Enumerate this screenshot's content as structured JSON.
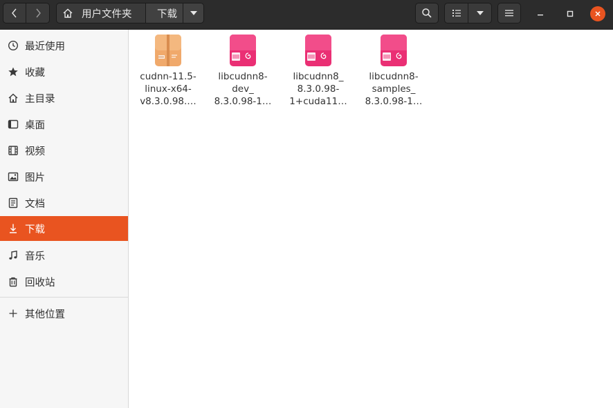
{
  "header": {
    "path": [
      {
        "label": "用户文件夹"
      },
      {
        "label": "下载"
      }
    ]
  },
  "sidebar": {
    "items": [
      {
        "label": "最近使用",
        "icon": "clock-icon"
      },
      {
        "label": "收藏",
        "icon": "star-icon"
      },
      {
        "label": "主目录",
        "icon": "home-icon"
      },
      {
        "label": "桌面",
        "icon": "desktop-icon"
      },
      {
        "label": "视频",
        "icon": "video-icon"
      },
      {
        "label": "图片",
        "icon": "picture-icon"
      },
      {
        "label": "文档",
        "icon": "document-icon"
      },
      {
        "label": "下载",
        "icon": "download-icon",
        "active": true
      },
      {
        "label": "音乐",
        "icon": "music-icon"
      },
      {
        "label": "回收站",
        "icon": "trash-icon"
      },
      {
        "label": "其他位置",
        "icon": "plus-icon"
      }
    ]
  },
  "files": [
    {
      "lines": [
        "cudnn-11.5-",
        "linux-x64-",
        "v8.3.0.98.…"
      ],
      "type": "archive",
      "icon": "archive-icon",
      "color": "#f0a96b"
    },
    {
      "lines": [
        "libcudnn8-",
        "dev_",
        "8.3.0.98-1…"
      ],
      "type": "deb",
      "icon": "debian-package-icon",
      "color": "#f0407f"
    },
    {
      "lines": [
        "libcudnn8_",
        "8.3.0.98-",
        "1+cuda11…"
      ],
      "type": "deb",
      "icon": "debian-package-icon",
      "color": "#f0407f"
    },
    {
      "lines": [
        "libcudnn8-",
        "samples_",
        "8.3.0.98-1…"
      ],
      "type": "deb",
      "icon": "debian-package-icon",
      "color": "#f0407f"
    }
  ],
  "colors": {
    "accent": "#e95420",
    "headerbar": "#2c2c2c",
    "sidebar": "#f6f6f6"
  }
}
